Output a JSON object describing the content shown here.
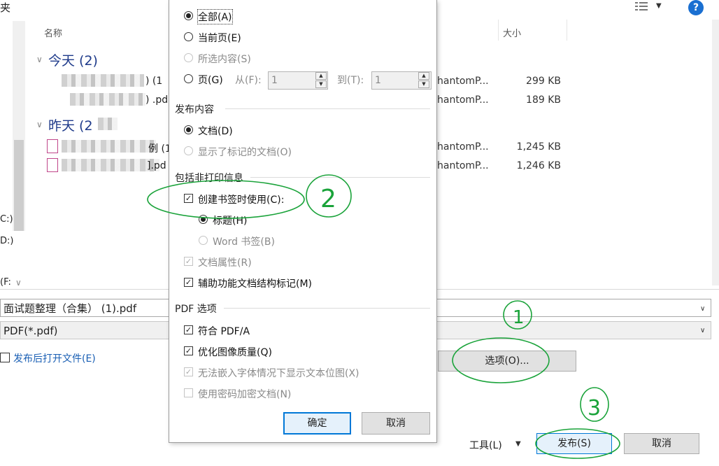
{
  "window": {
    "title_partial": "夹"
  },
  "toolbar": {
    "help_label": "?",
    "view_icon": "view-details-icon"
  },
  "columns": {
    "name": "名称",
    "size": "大小"
  },
  "nav": {
    "drives": [
      "C:)",
      "D:)",
      "(F:"
    ]
  },
  "groups": [
    {
      "label": "今天 (2)",
      "files": [
        {
          "name_suffix": ")  (1",
          "app": "hantomP...",
          "size": "299 KB"
        },
        {
          "name_suffix": ") .pd",
          "app": "hantomP...",
          "size": "189 KB"
        }
      ]
    },
    {
      "label": "昨天 (2",
      "files": [
        {
          "name_suffix": "例 (1",
          "app": "hantomP...",
          "size": "1,245 KB"
        },
        {
          "name_suffix": "].pd",
          "app": "hantomP...",
          "size": "1,246 KB"
        }
      ]
    }
  ],
  "form": {
    "filename": "面试题整理（合集） (1).pdf",
    "filetype": "PDF(*.pdf)",
    "open_after": "发布后打开文件(E)",
    "options_button": "选项(O)...",
    "tools_label": "工具(L)",
    "publish_button": "发布(S)",
    "cancel_button": "取消"
  },
  "options": {
    "range": {
      "all": "全部(A)",
      "current": "当前页(E)",
      "selection": "所选内容(S)",
      "pages": "页(G)",
      "from_label": "从(F):",
      "from_value": "1",
      "to_label": "到(T):",
      "to_value": "1"
    },
    "publish_content": {
      "title": "发布内容",
      "document": "文档(D)",
      "with_markup": "显示了标记的文档(O)"
    },
    "nonprint": {
      "title": "包括非打印信息",
      "bookmarks": "创建书签时使用(C):",
      "headings": "标题(H)",
      "word_bookmarks": "Word 书签(B)",
      "properties": "文档属性(R)",
      "accessibility": "辅助功能文档结构标记(M)"
    },
    "pdf_options": {
      "title": "PDF 选项",
      "pdfa": "符合 PDF/A",
      "optimize": "优化图像质量(Q)",
      "bitmap": "无法嵌入字体情况下显示文本位图(X)",
      "encrypt": "使用密码加密文档(N)"
    },
    "ok": "确定",
    "cancel": "取消"
  },
  "annotations": {
    "one": "1",
    "two": "2",
    "three": "3",
    "color": "#1aa33a"
  }
}
